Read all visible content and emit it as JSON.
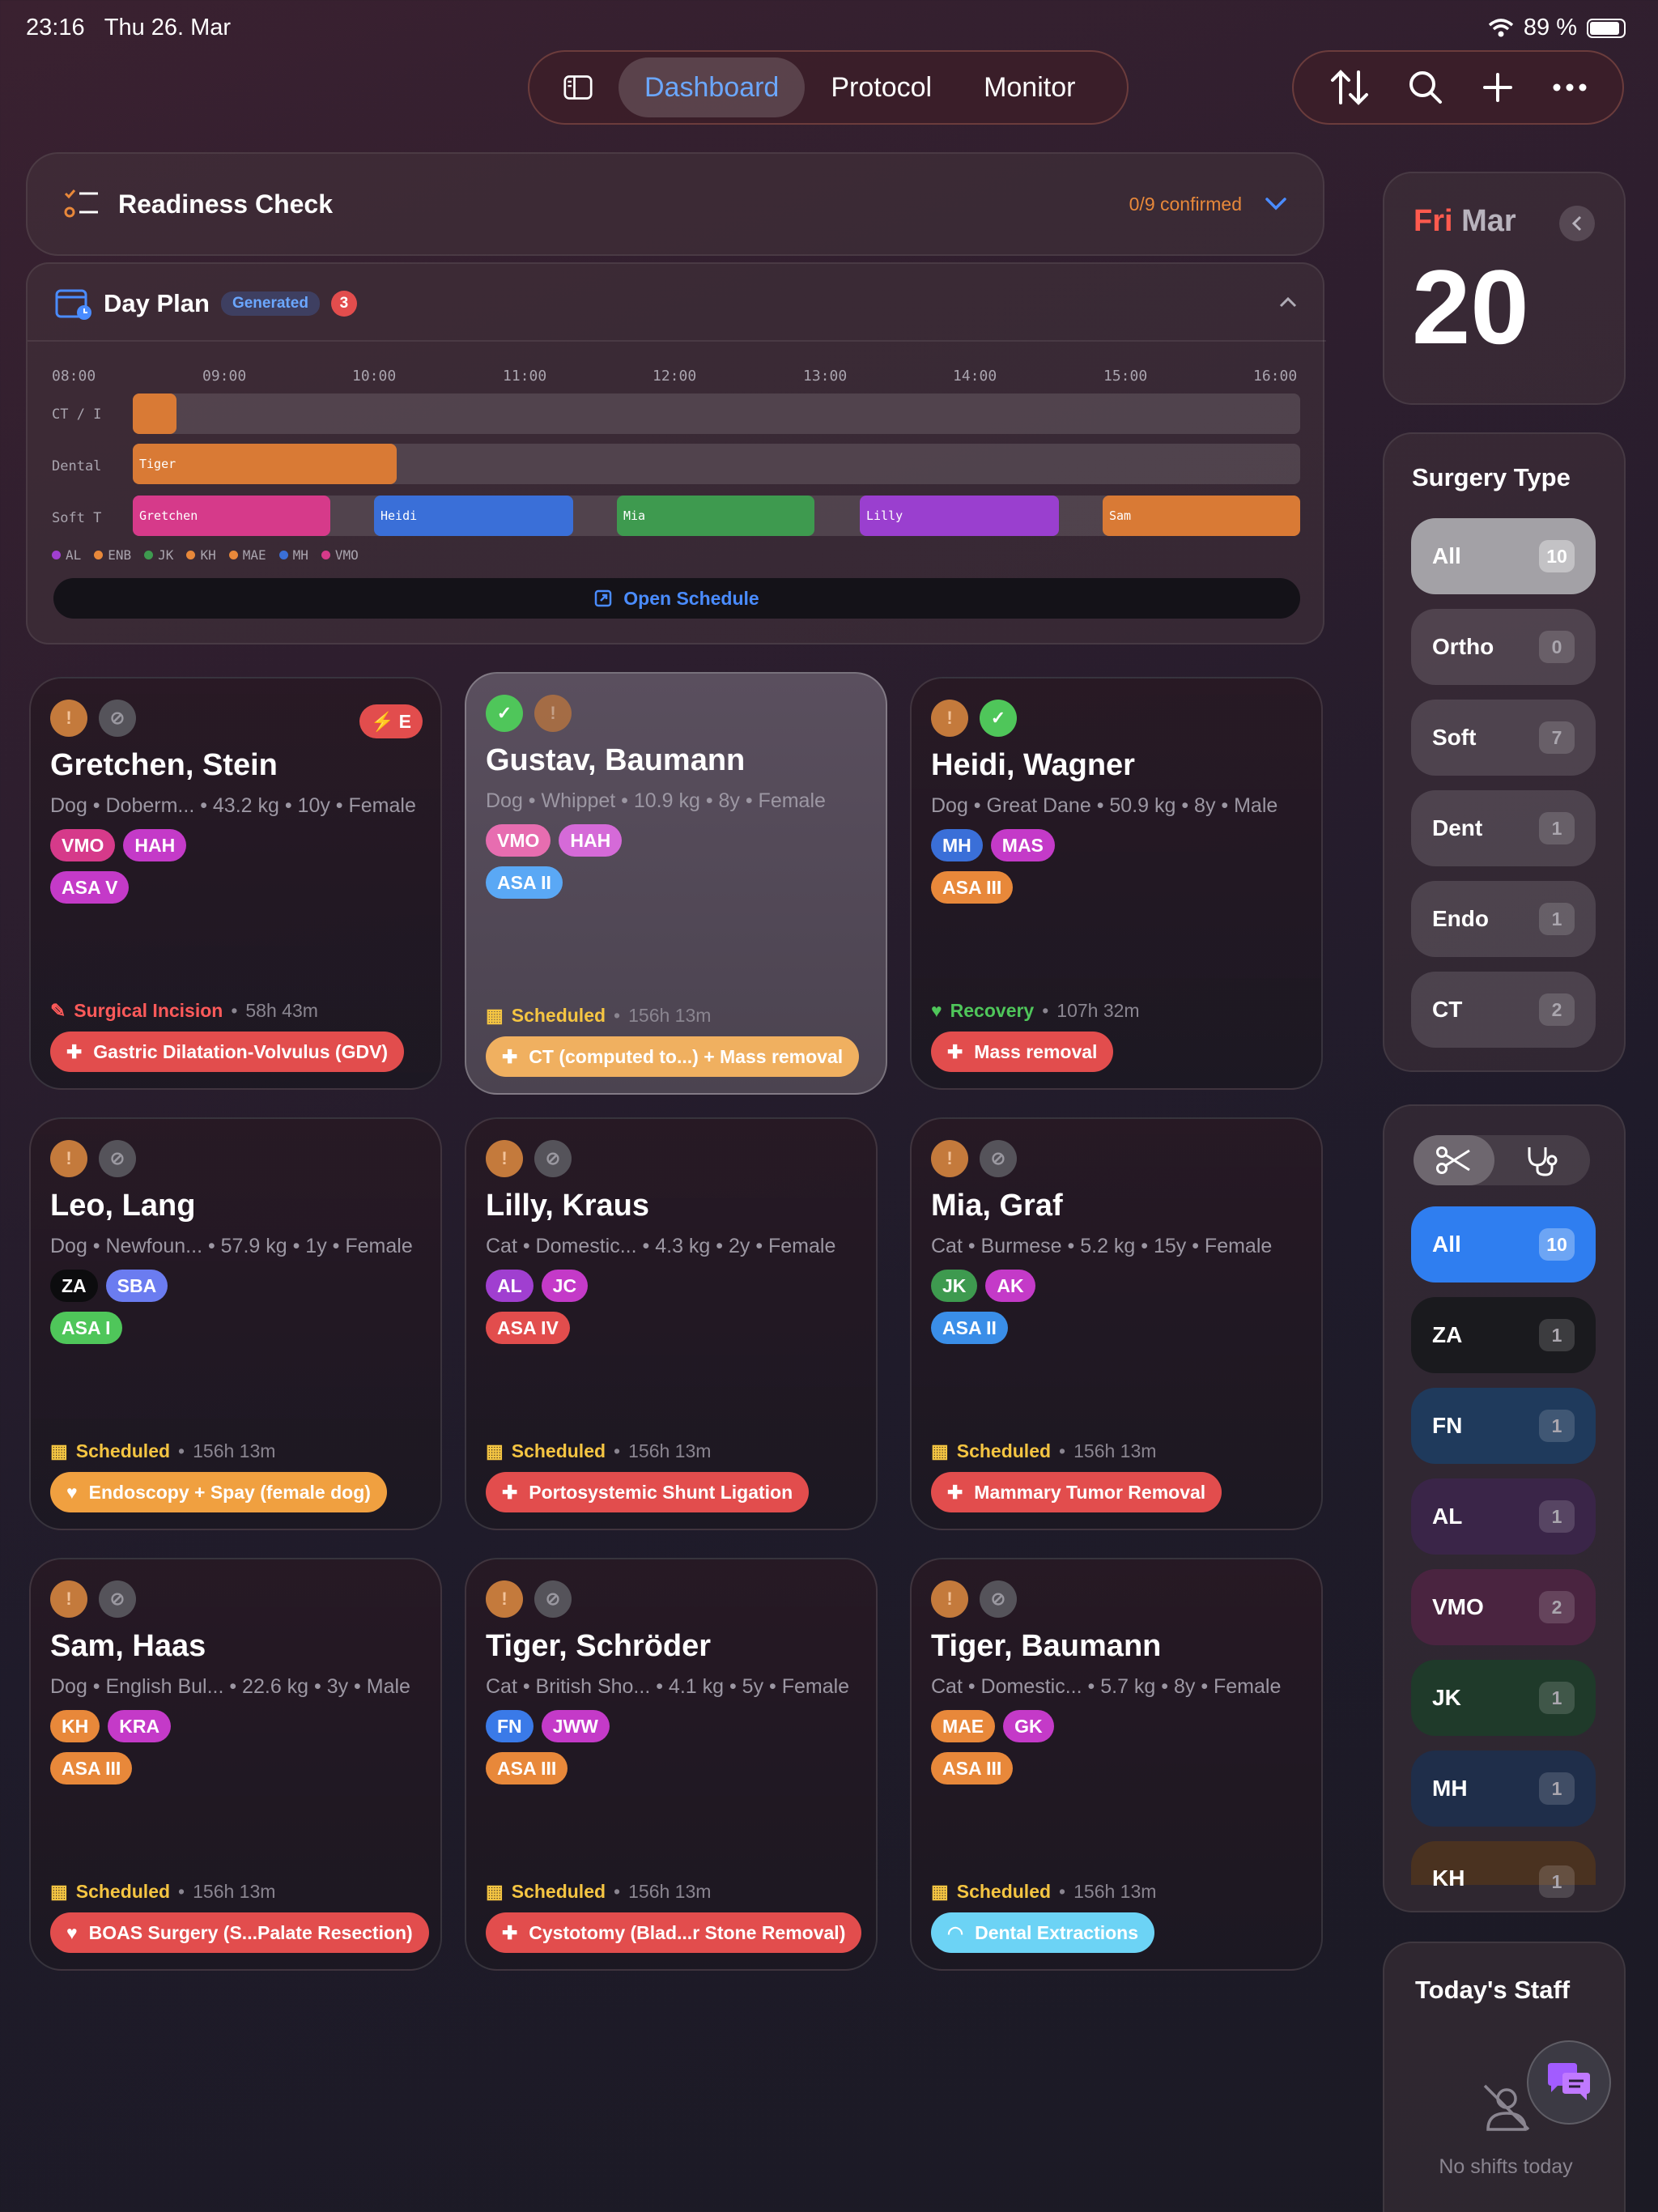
{
  "status": {
    "time": "23:16",
    "date": "Thu 26. Mar",
    "battery": "89 %"
  },
  "nav": {
    "tabs": [
      "Dashboard",
      "Protocol",
      "Monitor"
    ]
  },
  "readiness": {
    "title": "Readiness Check",
    "confirmed": "0/9 confirmed"
  },
  "dayplan": {
    "title": "Day Plan",
    "badge": "Generated",
    "count": "3",
    "hours": [
      "08:00",
      "09:00",
      "10:00",
      "11:00",
      "12:00",
      "13:00",
      "14:00",
      "15:00",
      "16:00"
    ],
    "rows": [
      "CT / I",
      "Dental",
      "Soft T"
    ],
    "blocks": {
      "dental": "Tiger",
      "soft": [
        "Gretchen",
        "Heidi",
        "Mia",
        "Lilly",
        "Sam"
      ]
    },
    "legend": [
      "AL",
      "ENB",
      "JK",
      "KH",
      "MAE",
      "MH",
      "VMO"
    ],
    "open": "Open Schedule"
  },
  "cards": [
    {
      "name": "Gretchen, Stein",
      "info": "Dog • Doberm... • 43.2 kg • 10y • Female",
      "tags": [
        "VMO",
        "HAH"
      ],
      "asa": "ASA V",
      "status": "Surgical Incision",
      "time": "58h 43m",
      "proc": "Gastric Dilatation-Volvulus (GDV)",
      "emergency": "E"
    },
    {
      "name": "Gustav, Baumann",
      "info": "Dog • Whippet • 10.9 kg • 8y • Female",
      "tags": [
        "VMO",
        "HAH"
      ],
      "asa": "ASA II",
      "status": "Scheduled",
      "time": "156h 13m",
      "proc": "CT (computed to...) + Mass removal"
    },
    {
      "name": "Heidi, Wagner",
      "info": "Dog • Great Dane • 50.9 kg • 8y • Male",
      "tags": [
        "MH",
        "MAS"
      ],
      "asa": "ASA III",
      "status": "Recovery",
      "time": "107h 32m",
      "proc": "Mass removal"
    },
    {
      "name": "Leo, Lang",
      "info": "Dog • Newfoun... • 57.9 kg • 1y • Female",
      "tags": [
        "ZA",
        "SBA"
      ],
      "asa": "ASA I",
      "status": "Scheduled",
      "time": "156h 13m",
      "proc": "Endoscopy + Spay (female dog)"
    },
    {
      "name": "Lilly, Kraus",
      "info": "Cat • Domestic... • 4.3 kg • 2y • Female",
      "tags": [
        "AL",
        "JC"
      ],
      "asa": "ASA IV",
      "status": "Scheduled",
      "time": "156h 13m",
      "proc": "Portosystemic Shunt Ligation"
    },
    {
      "name": "Mia, Graf",
      "info": "Cat • Burmese • 5.2 kg • 15y • Female",
      "tags": [
        "JK",
        "AK"
      ],
      "asa": "ASA II",
      "status": "Scheduled",
      "time": "156h 13m",
      "proc": "Mammary Tumor Removal"
    },
    {
      "name": "Sam, Haas",
      "info": "Dog • English Bul... • 22.6 kg • 3y • Male",
      "tags": [
        "KH",
        "KRA"
      ],
      "asa": "ASA III",
      "status": "Scheduled",
      "time": "156h 13m",
      "proc": "BOAS Surgery (S...Palate Resection)"
    },
    {
      "name": "Tiger, Schröder",
      "info": "Cat • British Sho... • 4.1 kg • 5y • Female",
      "tags": [
        "FN",
        "JWW"
      ],
      "asa": "ASA III",
      "status": "Scheduled",
      "time": "156h 13m",
      "proc": "Cystotomy (Blad...r Stone Removal)"
    },
    {
      "name": "Tiger, Baumann",
      "info": "Cat • Domestic... • 5.7 kg • 8y • Female",
      "tags": [
        "MAE",
        "GK"
      ],
      "asa": "ASA III",
      "status": "Scheduled",
      "time": "156h 13m",
      "proc": "Dental Extractions"
    }
  ],
  "calendar": {
    "weekday": "Fri",
    "month": "Mar",
    "day": "20"
  },
  "surgery": {
    "title": "Surgery Type",
    "items": [
      {
        "l": "All",
        "c": "10"
      },
      {
        "l": "Ortho",
        "c": "0"
      },
      {
        "l": "Soft",
        "c": "7"
      },
      {
        "l": "Dent",
        "c": "1"
      },
      {
        "l": "Endo",
        "c": "1"
      },
      {
        "l": "CT",
        "c": "2"
      }
    ]
  },
  "staff_filter": {
    "items": [
      {
        "l": "All",
        "c": "10"
      },
      {
        "l": "ZA",
        "c": "1"
      },
      {
        "l": "FN",
        "c": "1"
      },
      {
        "l": "AL",
        "c": "1"
      },
      {
        "l": "VMO",
        "c": "2"
      },
      {
        "l": "JK",
        "c": "1"
      },
      {
        "l": "MH",
        "c": "1"
      },
      {
        "l": "KH",
        "c": "1"
      }
    ]
  },
  "staff": {
    "title": "Today's Staff",
    "empty": "No shifts today"
  }
}
